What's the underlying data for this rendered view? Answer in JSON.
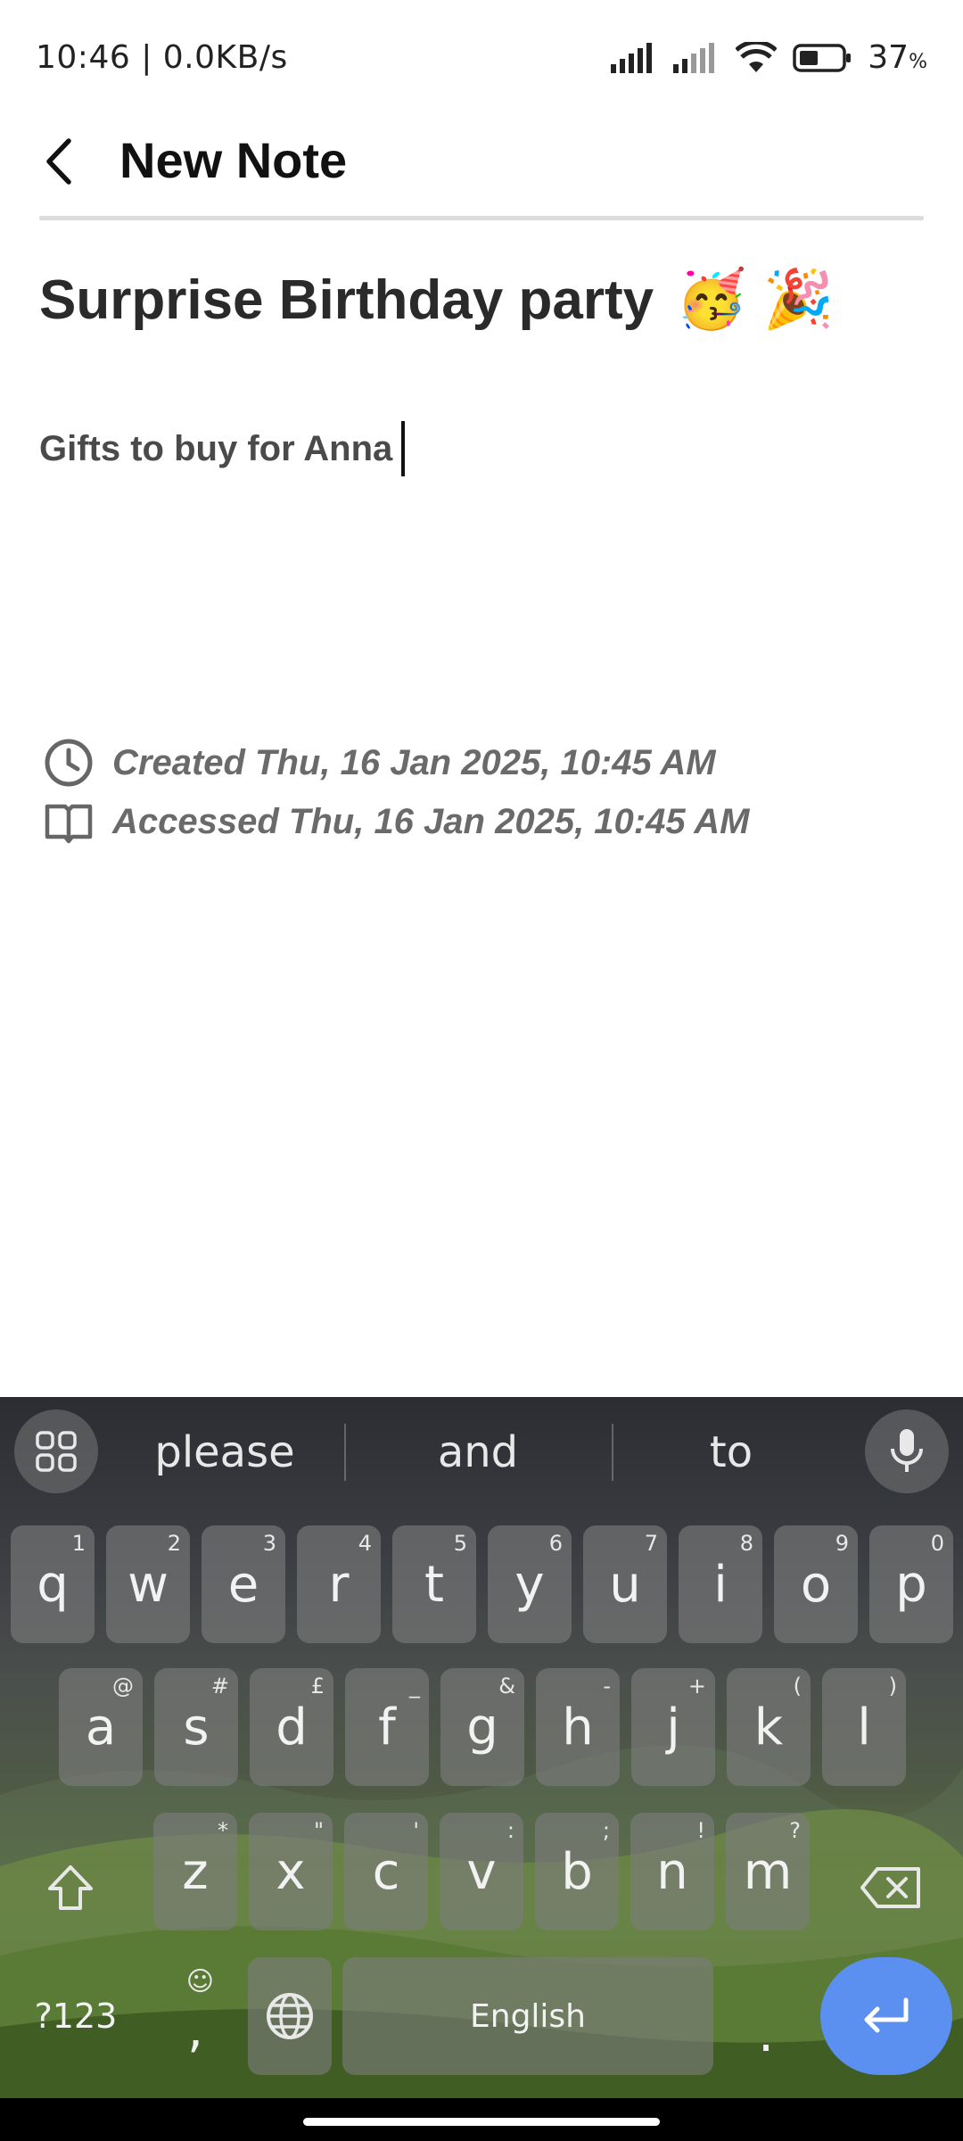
{
  "status_bar": {
    "time_speed": "10:46 | 0.0KB/s",
    "battery_percent": "37",
    "battery_unit": "%",
    "icons": [
      "signal-icon",
      "signal-icon",
      "wifi-icon",
      "battery-icon"
    ]
  },
  "header": {
    "title": "New Note",
    "back_icon": "chevron-left-icon"
  },
  "note": {
    "title": "Surprise Birthday party",
    "title_emoji": "🥳 🎉",
    "body": "Gifts to buy for Anna",
    "created": "Created Thu, 16 Jan 2025, 10:45 AM",
    "accessed": "Accessed Thu, 16 Jan 2025, 10:45 AM"
  },
  "keyboard": {
    "suggestions": [
      "please",
      "and",
      "to"
    ],
    "row1": [
      {
        "key": "q",
        "hint": "1"
      },
      {
        "key": "w",
        "hint": "2"
      },
      {
        "key": "e",
        "hint": "3"
      },
      {
        "key": "r",
        "hint": "4"
      },
      {
        "key": "t",
        "hint": "5"
      },
      {
        "key": "y",
        "hint": "6"
      },
      {
        "key": "u",
        "hint": "7"
      },
      {
        "key": "i",
        "hint": "8"
      },
      {
        "key": "o",
        "hint": "9"
      },
      {
        "key": "p",
        "hint": "0"
      }
    ],
    "row2": [
      {
        "key": "a",
        "hint": "@"
      },
      {
        "key": "s",
        "hint": "#"
      },
      {
        "key": "d",
        "hint": "£"
      },
      {
        "key": "f",
        "hint": "_"
      },
      {
        "key": "g",
        "hint": "&"
      },
      {
        "key": "h",
        "hint": "-"
      },
      {
        "key": "j",
        "hint": "+"
      },
      {
        "key": "k",
        "hint": "("
      },
      {
        "key": "l",
        "hint": ")"
      }
    ],
    "row3": [
      {
        "key": "z",
        "hint": "*"
      },
      {
        "key": "x",
        "hint": "\""
      },
      {
        "key": "c",
        "hint": "'"
      },
      {
        "key": "v",
        "hint": ":"
      },
      {
        "key": "b",
        "hint": ";"
      },
      {
        "key": "n",
        "hint": "!"
      },
      {
        "key": "m",
        "hint": "?"
      }
    ],
    "symbols_label": "?123",
    "comma_label": ",",
    "emoji_hint": "☺",
    "space_label": "English",
    "period_label": ".",
    "accent_color": "#5b8ff0"
  }
}
